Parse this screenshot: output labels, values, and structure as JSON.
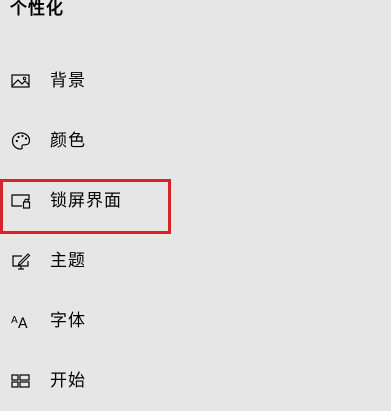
{
  "settings": {
    "section_title": "个性化",
    "nav_items": [
      {
        "label": "背景",
        "icon": "picture-icon"
      },
      {
        "label": "颜色",
        "icon": "palette-icon"
      },
      {
        "label": "锁屏界面",
        "icon": "lock-screen-icon"
      },
      {
        "label": "主题",
        "icon": "theme-icon"
      },
      {
        "label": "字体",
        "icon": "font-icon"
      },
      {
        "label": "开始",
        "icon": "start-icon"
      }
    ],
    "highlighted_item": "锁屏界面",
    "highlight_color": "#d9232b"
  }
}
